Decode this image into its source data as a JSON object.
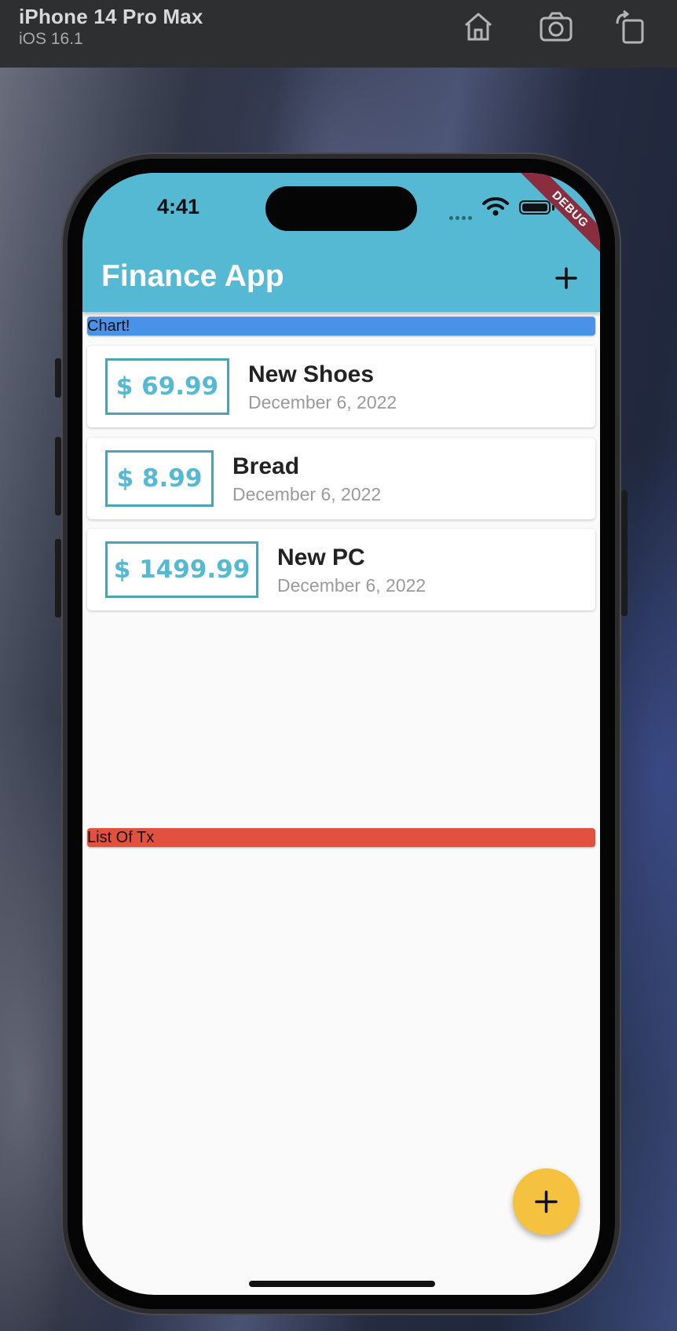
{
  "simulator": {
    "device": "iPhone 14 Pro Max",
    "os": "iOS 16.1",
    "icons": [
      "home-icon",
      "screenshot-icon",
      "rotate-icon"
    ]
  },
  "status_bar": {
    "time": "4:41",
    "debug_label": "DEBUG"
  },
  "appbar": {
    "title": "Finance App",
    "color": "#56b9d3"
  },
  "chart_section": {
    "label": "Chart!",
    "color": "#4a92e8"
  },
  "transactions": [
    {
      "amount": "$ 69.99",
      "title": "New Shoes",
      "date": "December 6, 2022"
    },
    {
      "amount": "$ 8.99",
      "title": "Bread",
      "date": "December 6, 2022"
    },
    {
      "amount": "$ 1499.99",
      "title": "New PC",
      "date": "December 6, 2022"
    }
  ],
  "list_section": {
    "label": "List Of Tx",
    "color": "#e2513f"
  },
  "fab": {
    "icon": "plus-icon",
    "color": "#f4c23f"
  }
}
